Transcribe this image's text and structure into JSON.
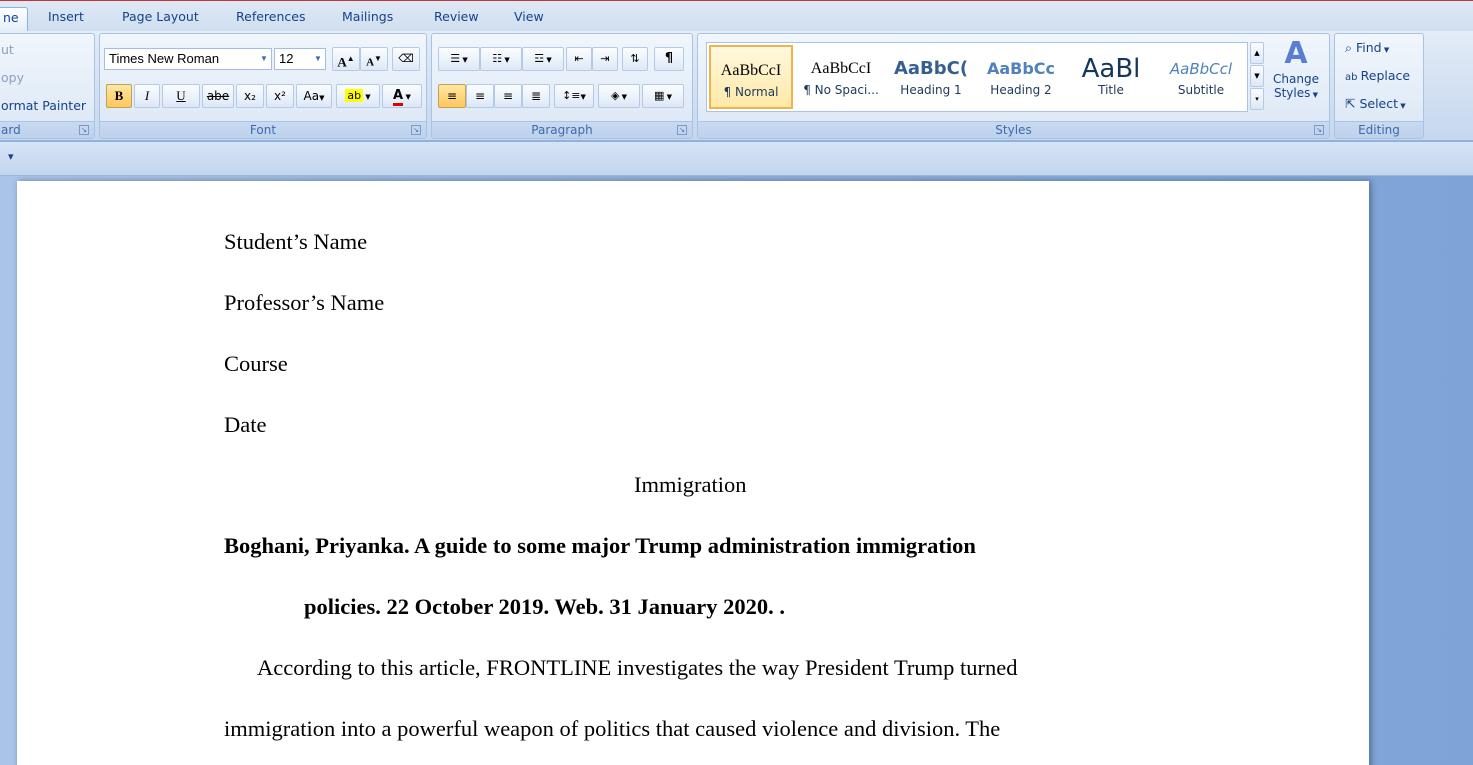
{
  "tabs": [
    {
      "label": "ne",
      "active": true
    },
    {
      "label": "Insert"
    },
    {
      "label": "Page Layout"
    },
    {
      "label": "References"
    },
    {
      "label": "Mailings"
    },
    {
      "label": "Review"
    },
    {
      "label": "View"
    }
  ],
  "clipboard": {
    "cut": "ut",
    "copy": "opy",
    "format_painter": "ormat Painter",
    "label": "ard"
  },
  "font": {
    "name": "Times New Roman",
    "size": "12",
    "label": "Font",
    "grow": "A",
    "shrink": "A",
    "bold": "B",
    "italic": "I",
    "underline": "U",
    "strike": "abe",
    "subscript": "x₂",
    "superscript": "x²",
    "change_case": "Aa",
    "highlight": "ab",
    "font_color": "A"
  },
  "paragraph": {
    "label": "Paragraph",
    "show_marks": "¶"
  },
  "styles": {
    "label": "Styles",
    "items": [
      {
        "sample": "AaBbCcI",
        "name": "¶ Normal"
      },
      {
        "sample": "AaBbCcI",
        "name": "¶ No Spaci..."
      },
      {
        "sample": "AaBbC(",
        "name": "Heading 1"
      },
      {
        "sample": "AaBbCc",
        "name": "Heading 2"
      },
      {
        "sample": "AaBl",
        "name": "Title"
      },
      {
        "sample": "AaBbCcl",
        "name": "Subtitle"
      }
    ],
    "change_styles_line1": "Change",
    "change_styles_line2": "Styles"
  },
  "editing": {
    "label": "Editing",
    "find": "Find",
    "replace": "Replace",
    "select": "Select"
  },
  "document": {
    "lines": [
      "Student’s Name",
      "Professor’s Name",
      "Course",
      "Date",
      "Immigration",
      "Boghani, Priyanka.  A guide to some major  Trump  administration  immigration",
      "policies. 22 October 2019. Web.  31 January 2020. .",
      "According to this article,  FRONTLINE  investigates the way President  Trump turned",
      "immigration into a powerful weapon of politics that caused violence and division. The"
    ]
  }
}
